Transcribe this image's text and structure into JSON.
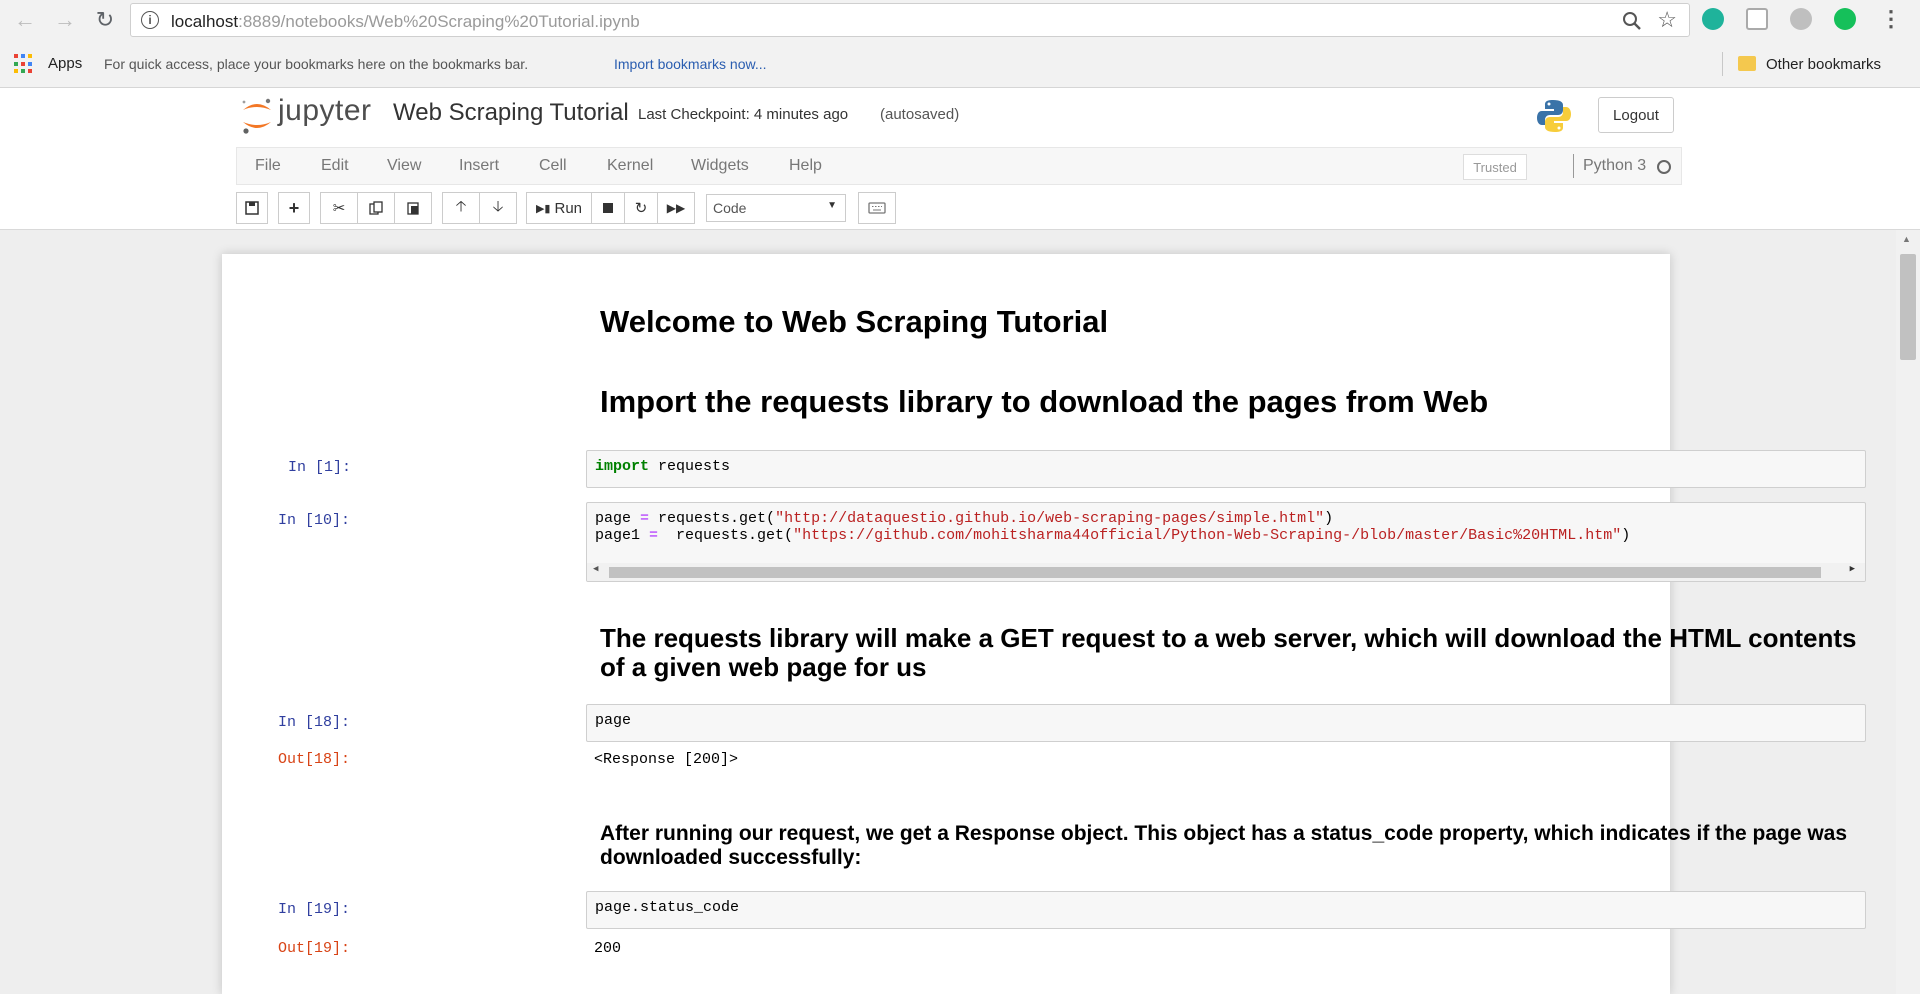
{
  "browser": {
    "url_host": "localhost",
    "url_rest": ":8889/notebooks/Web%20Scraping%20Tutorial.ipynb",
    "bookmarks": {
      "apps_label": "Apps",
      "hint": "For quick access, place your bookmarks here on the bookmarks bar.",
      "import_link": "Import bookmarks now...",
      "other": "Other bookmarks"
    }
  },
  "jupyter": {
    "wordmark": "jupyter",
    "notebook_title": "Web Scraping Tutorial",
    "checkpoint": "Last Checkpoint: 4 minutes ago",
    "autosave": "(autosaved)",
    "logout_label": "Logout",
    "menu": [
      "File",
      "Edit",
      "View",
      "Insert",
      "Cell",
      "Kernel",
      "Widgets",
      "Help"
    ],
    "trusted_label": "Trusted",
    "kernel_name": "Python 3",
    "toolbar": {
      "run_label": "Run",
      "cell_type": "Code"
    }
  },
  "cells": {
    "h1_welcome": "Welcome to Web Scraping Tutorial",
    "h1_import": "Import the requests library to download the pages from Web",
    "c1": {
      "prompt": "In [1]:",
      "kw": "import",
      "rest": " requests"
    },
    "c10": {
      "prompt": "In [10]:",
      "line1_a": "page ",
      "line1_op": "=",
      "line1_b": " requests.get(",
      "line1_str": "\"http://dataquestio.github.io/web-scraping-pages/simple.html\"",
      "line1_c": ")",
      "line2_a": "page1 ",
      "line2_op": "=",
      "line2_b": "  requests.get(",
      "line2_str": "\"https://github.com/mohitsharma44official/Python-Web-Scraping-/blob/master/Basic%20HTML.htm\"",
      "line2_c": ")"
    },
    "md_requests": "The requests library will make a GET request to a web server, which will download the HTML contents of a given web page for us",
    "c18": {
      "prompt": "In [18]:",
      "code": "page",
      "out_prompt": "Out[18]:",
      "out": "<Response [200]>"
    },
    "md_response": "After running our request, we get a Response object. This object has a status_code property, which indicates if the page was downloaded successfully:",
    "c19": {
      "prompt": "In [19]:",
      "code": "page.status_code",
      "out_prompt": "Out[19]:",
      "out": "200"
    }
  }
}
